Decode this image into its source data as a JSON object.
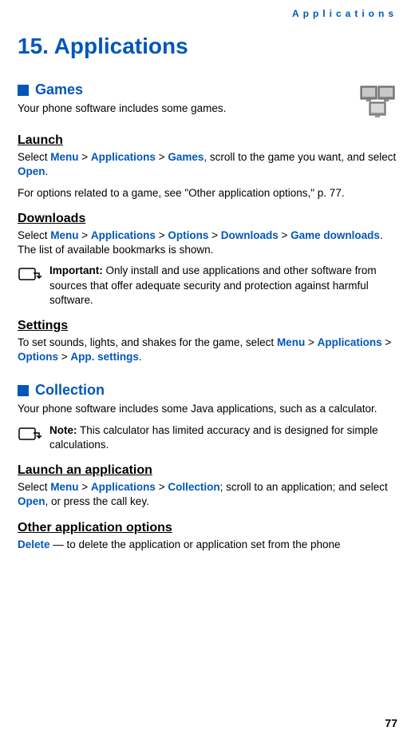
{
  "header": "Applications",
  "chapter_title": "15. Applications",
  "games": {
    "title": "Games",
    "intro": "Your phone software includes some games.",
    "launch": {
      "title": "Launch",
      "pre": "Select ",
      "path": [
        "Menu",
        "Applications",
        "Games"
      ],
      "post": ", scroll to the game you want, and select ",
      "action": "Open",
      "post2": ".",
      "options_text": "For options related to a game, see \"Other application options,\" p. 77."
    },
    "downloads": {
      "title": "Downloads",
      "pre": "Select ",
      "path": [
        "Menu",
        "Applications",
        "Options",
        "Downloads",
        "Game downloads"
      ],
      "post": ". The list of available bookmarks is shown.",
      "important_label": "Important:",
      "important_text": " Only install and use applications and other software from sources that offer adequate security and protection against harmful software."
    },
    "settings": {
      "title": "Settings",
      "pre": "To set sounds, lights, and shakes for the game, select ",
      "path": [
        "Menu",
        "Applications",
        "Options",
        "App. settings"
      ],
      "post": "."
    }
  },
  "collection": {
    "title": "Collection",
    "intro": "Your phone software includes some Java applications, such as a calculator.",
    "note_label": "Note:",
    "note_text": " This calculator has limited accuracy and is designed for simple calculations.",
    "launch": {
      "title": "Launch an application",
      "pre": "Select ",
      "path": [
        "Menu",
        "Applications",
        "Collection"
      ],
      "post": "; scroll to an application; and select ",
      "action": "Open",
      "post2": ", or press the call key."
    },
    "other": {
      "title": "Other application options",
      "delete_label": "Delete",
      "delete_text": " — to delete the application or application set from the phone"
    }
  },
  "page_number": "77"
}
